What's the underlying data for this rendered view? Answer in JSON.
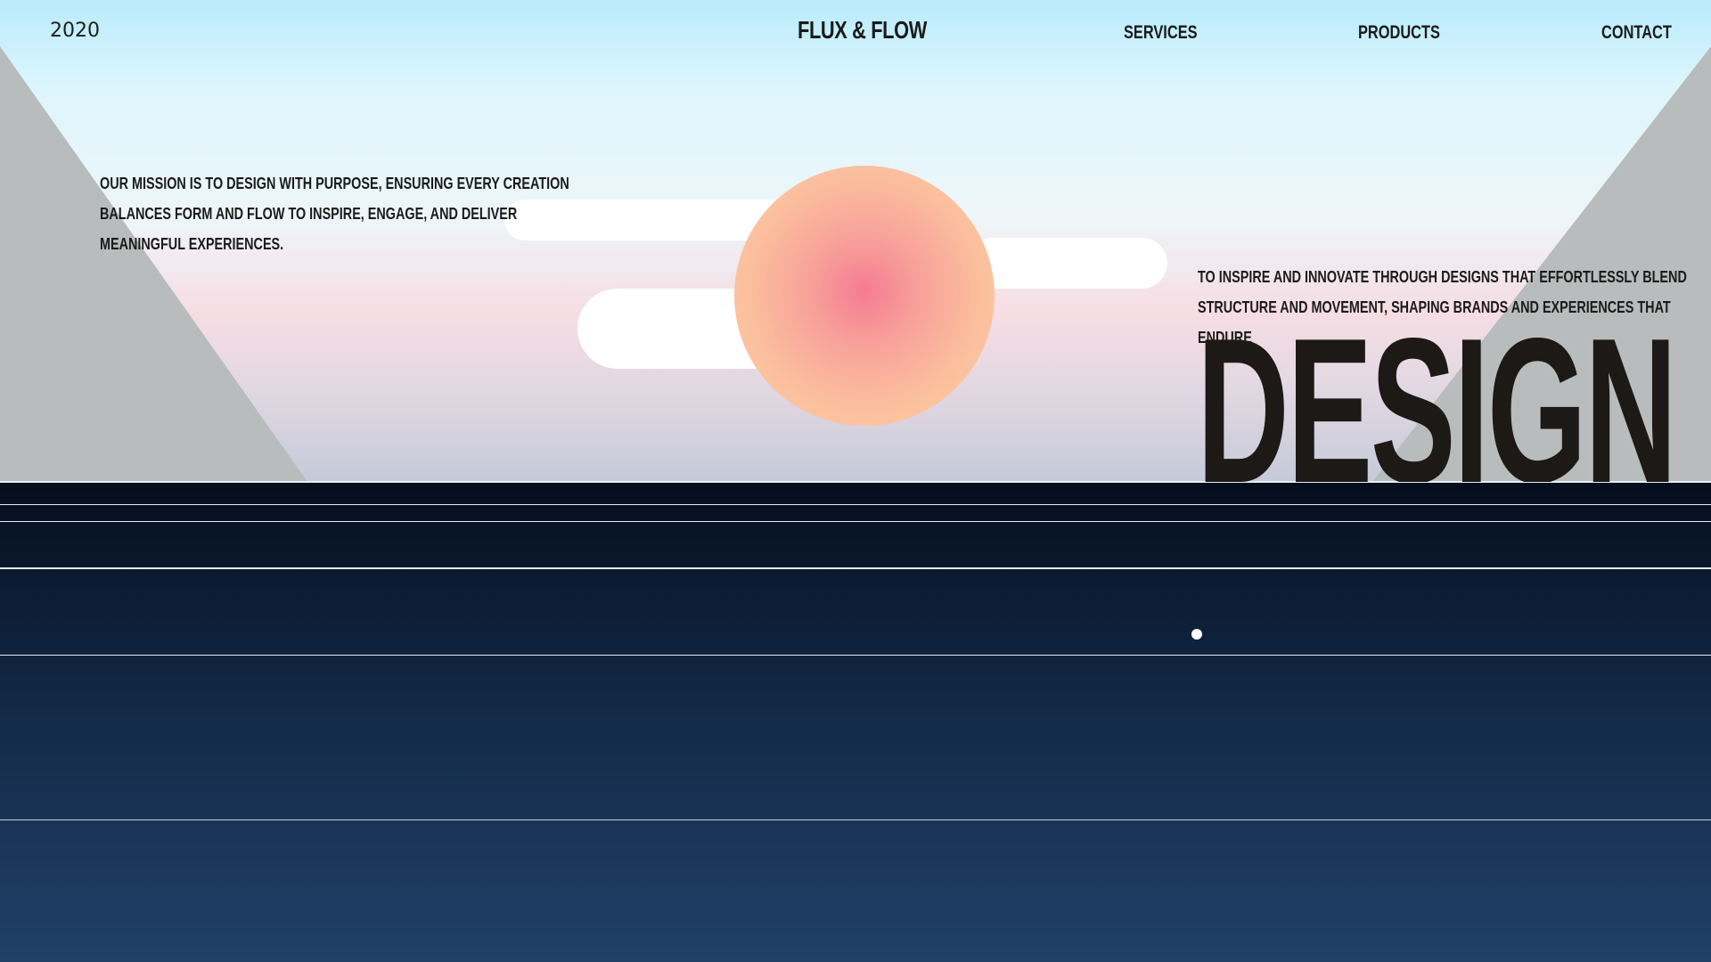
{
  "header": {
    "year": "2020",
    "brand": "FLUX & FLOW",
    "nav": {
      "services": "SERVICES",
      "products": "PRODUCTS",
      "contact": "CONTACT"
    }
  },
  "hero": {
    "mission": "OUR MISSION IS TO DESIGN WITH PURPOSE, ENSURING EVERY CREATION BALANCES FORM AND FLOW TO INSPIRE, ENGAGE, AND DELIVER MEANINGFUL EXPERIENCES.",
    "vision": "TO INSPIRE AND INNOVATE THROUGH DESIGNS THAT EFFORTLESSLY BLEND STRUCTURE AND MOVEMENT, SHAPING BRANDS AND EXPERIENCES THAT ENDURE",
    "headline": "DESIGN"
  },
  "colors": {
    "sky_top": "#b9ebfb",
    "sky_bottom": "#c5cad9",
    "sun_center": "#f57c93",
    "sun_edge": "#fdd3a6",
    "mountain": "#b9bcbc",
    "sea_top": "#050d1c",
    "sea_bottom": "#204068",
    "text": "#1b1b1b"
  }
}
